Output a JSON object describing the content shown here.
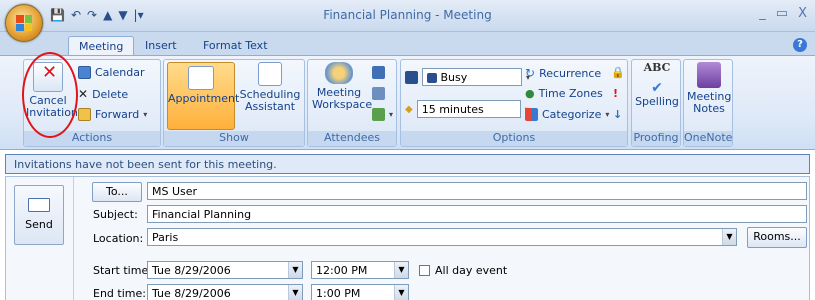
{
  "window": {
    "title": "Financial Planning - Meeting",
    "controls": [
      "_",
      "▭",
      "X"
    ]
  },
  "qat": {
    "icons": [
      "save-icon",
      "undo-icon",
      "redo-icon",
      "up-icon",
      "down-icon",
      "customize-icon"
    ]
  },
  "tabs": [
    {
      "label": "Meeting"
    },
    {
      "label": "Insert"
    },
    {
      "label": "Format Text"
    }
  ],
  "help": "?",
  "ribbon": {
    "actions": {
      "cancel_invitation": "Cancel Invitation",
      "calendar": "Calendar",
      "delete": "Delete",
      "forward": "Forward",
      "label": "Actions"
    },
    "show": {
      "appointment": "Appointment",
      "scheduling": "Scheduling Assistant",
      "label": "Show"
    },
    "attendees": {
      "meeting_workspace": "Meeting Workspace",
      "label": "Attendees"
    },
    "options": {
      "show_as": "Busy",
      "reminder": "15 minutes",
      "recurrence": "Recurrence",
      "time_zones": "Time Zones",
      "categorize": "Categorize",
      "label": "Options"
    },
    "proofing": {
      "spelling": "Spelling",
      "label": "Proofing",
      "abc": "ABC"
    },
    "onenote": {
      "meeting_notes": "Meeting Notes",
      "label": "OneNote"
    }
  },
  "infobar": "Invitations have not been sent for this meeting.",
  "form": {
    "send": "Send",
    "to_button": "To...",
    "to_value": "MS User",
    "subject_label": "Subject:",
    "subject_value": "Financial Planning",
    "location_label": "Location:",
    "location_value": "Paris",
    "rooms_button": "Rooms...",
    "start_label": "Start time:",
    "start_date": "Tue 8/29/2006",
    "start_time": "12:00 PM",
    "all_day": "All day event",
    "end_label": "End time:",
    "end_date": "Tue 8/29/2006",
    "end_time": "1:00 PM"
  }
}
